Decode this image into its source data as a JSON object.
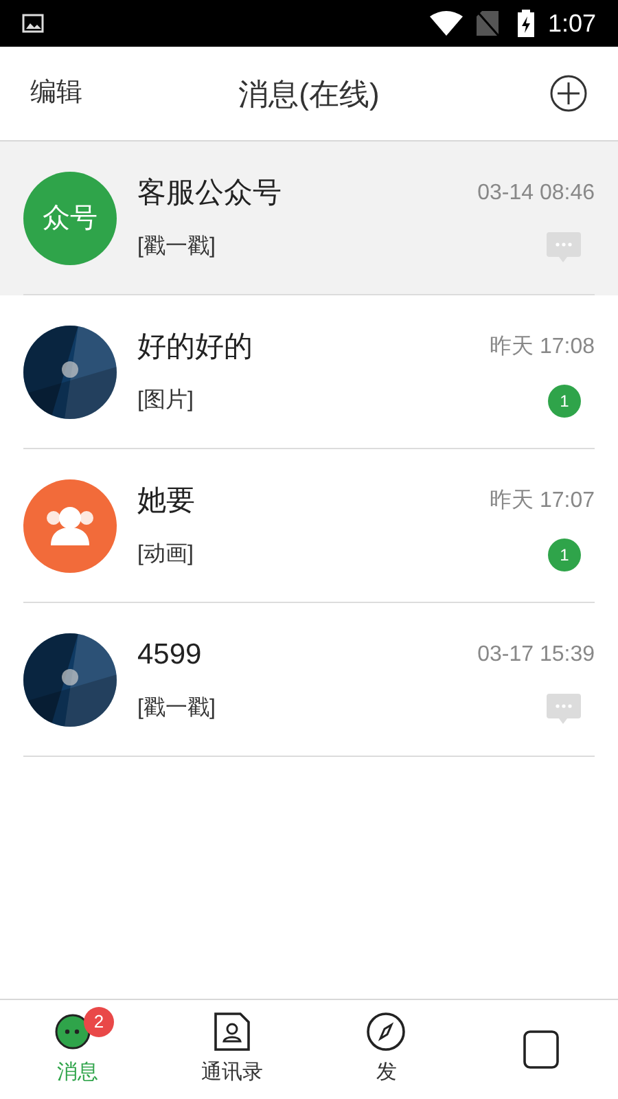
{
  "status_bar": {
    "time": "1:07"
  },
  "header": {
    "left": "编辑",
    "title": "消息(在线)"
  },
  "conversations": [
    {
      "name": "客服公众号",
      "preview": "[戳一戳]",
      "time": "03-14 08:46",
      "selected": true,
      "avatar": {
        "kind": "text",
        "text": "众号",
        "color": "#2fa44a"
      },
      "indicator": {
        "kind": "chat"
      }
    },
    {
      "name": "好的好的",
      "preview": "[图片]",
      "time": "昨天 17:08",
      "selected": false,
      "indicator": {
        "kind": "badge",
        "count": "1"
      }
    },
    {
      "name": "她要",
      "preview": "[动画]",
      "time": "昨天 17:07",
      "selected": false,
      "avatar": {
        "kind": "group",
        "color": "#f26b3a"
      },
      "indicator": {
        "kind": "badge",
        "count": "1"
      }
    },
    {
      "name": "4599",
      "preview": "[戳一戳]",
      "time": "03-17 15:39",
      "selected": false,
      "indicator": {
        "kind": "chat"
      }
    }
  ],
  "tabs": [
    {
      "kind": "chat",
      "label": "消息",
      "selected": true,
      "badge": "2"
    },
    {
      "kind": "contacts",
      "label": "通讯录",
      "selected": false
    },
    {
      "kind": "compass",
      "label": "发",
      "selected": false
    },
    {
      "kind": "me",
      "selected": false
    }
  ]
}
